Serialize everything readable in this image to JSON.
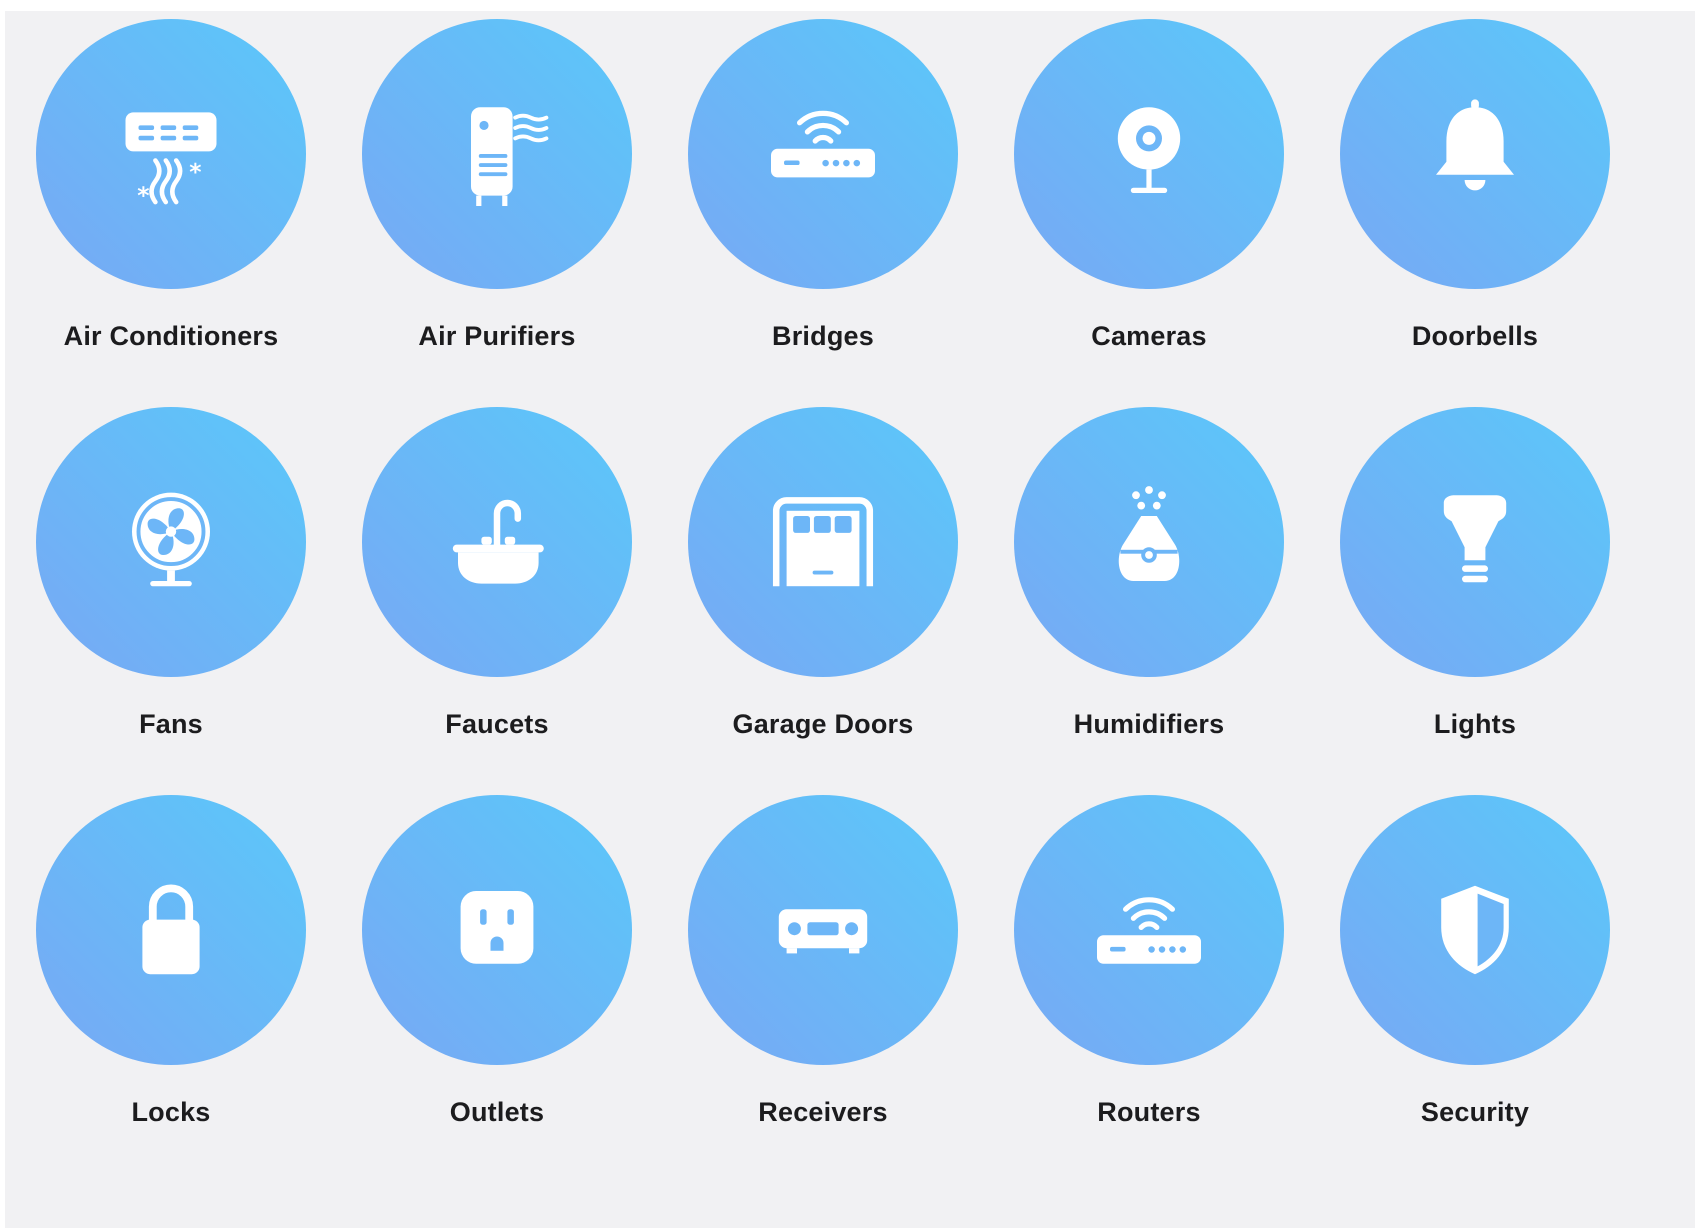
{
  "categories": [
    {
      "label": "Air Conditioners",
      "icon": "air-conditioner-icon"
    },
    {
      "label": "Air Purifiers",
      "icon": "air-purifier-icon"
    },
    {
      "label": "Bridges",
      "icon": "bridge-icon"
    },
    {
      "label": "Cameras",
      "icon": "camera-icon"
    },
    {
      "label": "Doorbells",
      "icon": "bell-icon"
    },
    {
      "label": "Fans",
      "icon": "fan-icon"
    },
    {
      "label": "Faucets",
      "icon": "faucet-icon"
    },
    {
      "label": "Garage Doors",
      "icon": "garage-door-icon"
    },
    {
      "label": "Humidifiers",
      "icon": "humidifier-icon"
    },
    {
      "label": "Lights",
      "icon": "lightbulb-icon"
    },
    {
      "label": "Locks",
      "icon": "lock-icon"
    },
    {
      "label": "Outlets",
      "icon": "outlet-icon"
    },
    {
      "label": "Receivers",
      "icon": "receiver-icon"
    },
    {
      "label": "Routers",
      "icon": "router-icon"
    },
    {
      "label": "Security",
      "icon": "shield-icon"
    }
  ],
  "colors": {
    "background": "#f1f1f3",
    "gradient_start": "#78a8f4",
    "gradient_end": "#5ac8fa",
    "label": "#1c1c1e",
    "icon": "#ffffff"
  }
}
